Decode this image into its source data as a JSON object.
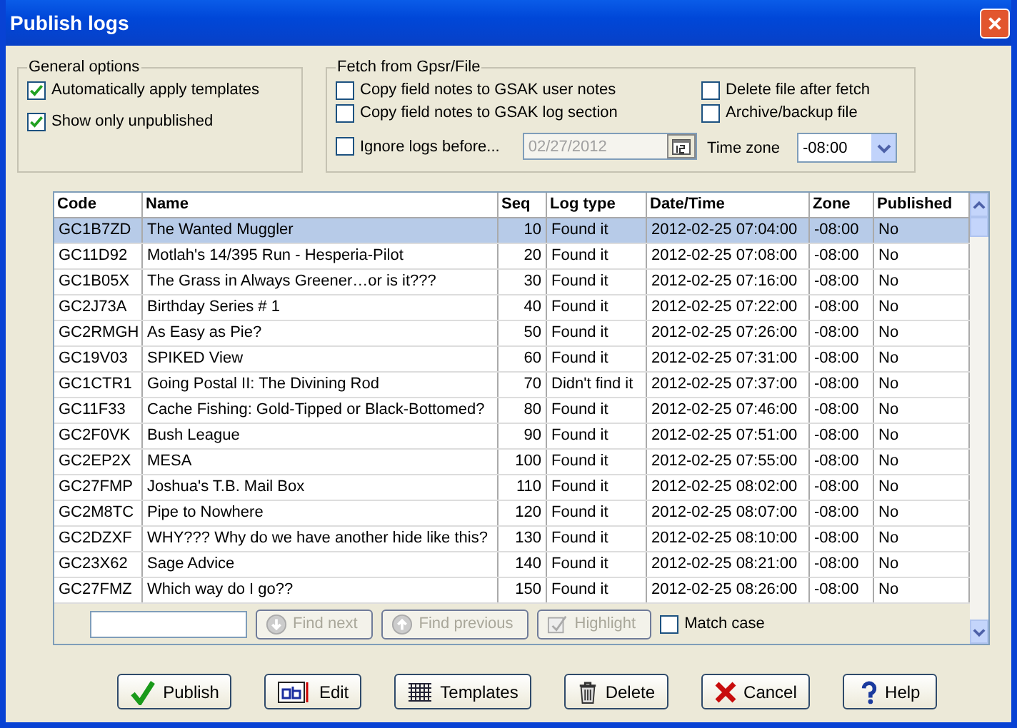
{
  "window": {
    "title": "Publish logs"
  },
  "general_options": {
    "title": "General options",
    "options": [
      {
        "label": "Automatically apply templates",
        "checked": true
      },
      {
        "label": "Show only unpublished",
        "checked": true
      }
    ]
  },
  "fetch": {
    "title": "Fetch from Gpsr/File",
    "left_options": [
      {
        "label": "Copy field notes to GSAK user notes",
        "checked": false
      },
      {
        "label": "Copy field notes to GSAK log section",
        "checked": false
      }
    ],
    "ignore_before": {
      "label": "Ignore logs before...",
      "checked": false,
      "date": "02/27/2012",
      "disabled": true
    },
    "right_options": [
      {
        "label": "Delete file after fetch",
        "checked": false
      },
      {
        "label": "Archive/backup file",
        "checked": false
      }
    ],
    "time_zone": {
      "label": "Time zone",
      "value": "-08:00"
    }
  },
  "table": {
    "columns": [
      "Code",
      "Name",
      "Seq",
      "Log type",
      "Date/Time",
      "Zone",
      "Published"
    ],
    "rows": [
      {
        "cells": [
          "GC1B7ZD",
          "The Wanted Muggler",
          "10",
          "Found it",
          "2012-02-25 07:04:00",
          "-08:00",
          "No"
        ],
        "selected": true
      },
      {
        "cells": [
          "GC11D92",
          "Motlah's 14/395 Run - Hesperia-Pilot",
          "20",
          "Found it",
          "2012-02-25 07:08:00",
          "-08:00",
          "No"
        ],
        "selected": false
      },
      {
        "cells": [
          "GC1B05X",
          "The Grass in Always Greener…or is it???",
          "30",
          "Found it",
          "2012-02-25 07:16:00",
          "-08:00",
          "No"
        ],
        "selected": false
      },
      {
        "cells": [
          "GC2J73A",
          "Birthday Series # 1",
          "40",
          "Found it",
          "2012-02-25 07:22:00",
          "-08:00",
          "No"
        ],
        "selected": false
      },
      {
        "cells": [
          "GC2RMGH",
          "As Easy as Pie?",
          "50",
          "Found it",
          "2012-02-25 07:26:00",
          "-08:00",
          "No"
        ],
        "selected": false
      },
      {
        "cells": [
          "GC19V03",
          "SPIKED View",
          "60",
          "Found it",
          "2012-02-25 07:31:00",
          "-08:00",
          "No"
        ],
        "selected": false
      },
      {
        "cells": [
          "GC1CTR1",
          "Going Postal II: The Divining Rod",
          "70",
          "Didn't find it",
          "2012-02-25 07:37:00",
          "-08:00",
          "No"
        ],
        "selected": false
      },
      {
        "cells": [
          "GC11F33",
          "Cache Fishing: Gold-Tipped or Black-Bottomed?",
          "80",
          "Found it",
          "2012-02-25 07:46:00",
          "-08:00",
          "No"
        ],
        "selected": false
      },
      {
        "cells": [
          "GC2F0VK",
          "Bush League",
          "90",
          "Found it",
          "2012-02-25 07:51:00",
          "-08:00",
          "No"
        ],
        "selected": false
      },
      {
        "cells": [
          "GC2EP2X",
          "MESA",
          "100",
          "Found it",
          "2012-02-25 07:55:00",
          "-08:00",
          "No"
        ],
        "selected": false
      },
      {
        "cells": [
          "GC27FMP",
          "Joshua's T.B. Mail Box",
          "110",
          "Found it",
          "2012-02-25 08:02:00",
          "-08:00",
          "No"
        ],
        "selected": false
      },
      {
        "cells": [
          "GC2M8TC",
          "Pipe to Nowhere",
          "120",
          "Found it",
          "2012-02-25 08:07:00",
          "-08:00",
          "No"
        ],
        "selected": false
      },
      {
        "cells": [
          "GC2DZXF",
          "WHY??? Why do we have another hide like this?",
          "130",
          "Found it",
          "2012-02-25 08:10:00",
          "-08:00",
          "No"
        ],
        "selected": false
      },
      {
        "cells": [
          "GC23X62",
          "Sage Advice",
          "140",
          "Found it",
          "2012-02-25 08:21:00",
          "-08:00",
          "No"
        ],
        "selected": false
      },
      {
        "cells": [
          "GC27FMZ",
          "Which way do I go??",
          "150",
          "Found it",
          "2012-02-25 08:26:00",
          "-08:00",
          "No"
        ],
        "selected": false
      }
    ]
  },
  "find_bar": {
    "buttons": [
      {
        "label": "Find next",
        "disabled": true
      },
      {
        "label": "Find previous",
        "disabled": true
      },
      {
        "label": "Highlight",
        "disabled": true
      }
    ],
    "match_case": {
      "label": "Match case",
      "checked": false
    }
  },
  "buttons": [
    "Publish",
    "Edit",
    "Templates",
    "Delete",
    "Cancel",
    "Help"
  ]
}
